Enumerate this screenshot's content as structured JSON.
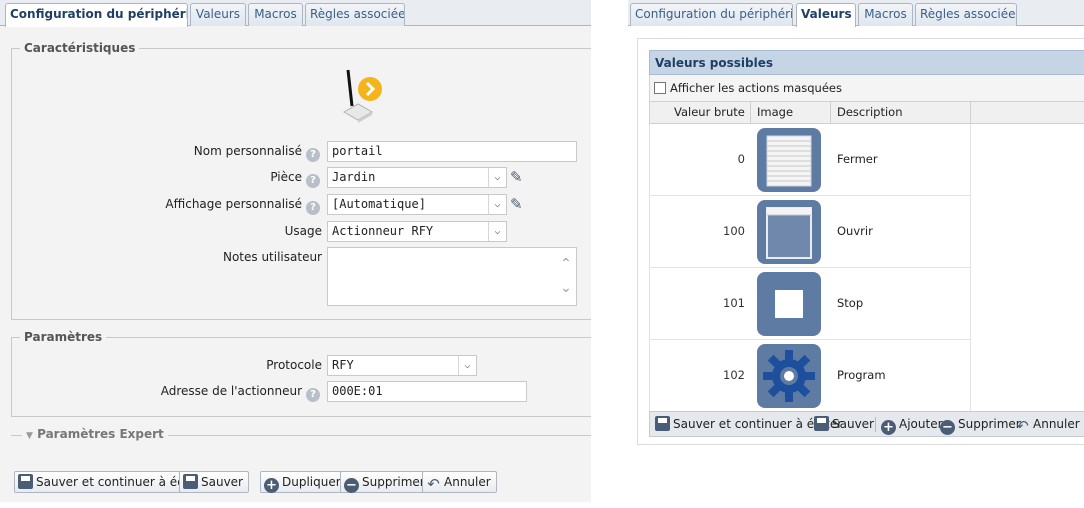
{
  "left": {
    "tabs": [
      "Configuration du périphérique",
      "Valeurs",
      "Macros",
      "Règles associées"
    ],
    "caracteristiques": {
      "legend": "Caractéristiques",
      "nom_label": "Nom personnalisé",
      "nom_value": "portail",
      "piece_label": "Pièce",
      "piece_value": "Jardin",
      "affichage_label": "Affichage personnalisé",
      "affichage_value": "[Automatique]",
      "usage_label": "Usage",
      "usage_value": "Actionneur RFY",
      "notes_label": "Notes utilisateur"
    },
    "parametres": {
      "legend": "Paramètres",
      "protocole_label": "Protocole",
      "protocole_value": "RFY",
      "adresse_label": "Adresse de l'actionneur",
      "adresse_value": "000E:01"
    },
    "expert_legend": "Paramètres Expert",
    "buttons": {
      "save_continue": "Sauver et continuer à éditer",
      "save": "Sauver",
      "duplicate": "Dupliquer",
      "delete": "Supprimer",
      "cancel": "Annuler"
    }
  },
  "right": {
    "tabs": [
      "Configuration du périphérique",
      "Valeurs",
      "Macros",
      "Règles associées"
    ],
    "title": "Valeurs possibles",
    "show_hidden": "Afficher les actions masquées",
    "columns": [
      "Valeur brute",
      "Image",
      "Description"
    ],
    "rows": [
      {
        "value": "0",
        "icon": "shutter-closed-icon",
        "description": "Fermer"
      },
      {
        "value": "100",
        "icon": "shutter-open-icon",
        "description": "Ouvrir"
      },
      {
        "value": "101",
        "icon": "stop-icon",
        "description": "Stop"
      },
      {
        "value": "102",
        "icon": "gear-icon",
        "description": "Program"
      }
    ],
    "footer": {
      "save_continue": "Sauver et continuer à éditer",
      "save": "Sauver",
      "add": "Ajouter",
      "delete": "Supprimer",
      "cancel": "Annuler"
    }
  },
  "colors": {
    "accent": "#1f3f66",
    "tile": "#5e7ba3",
    "badge": "#f4b41a"
  }
}
